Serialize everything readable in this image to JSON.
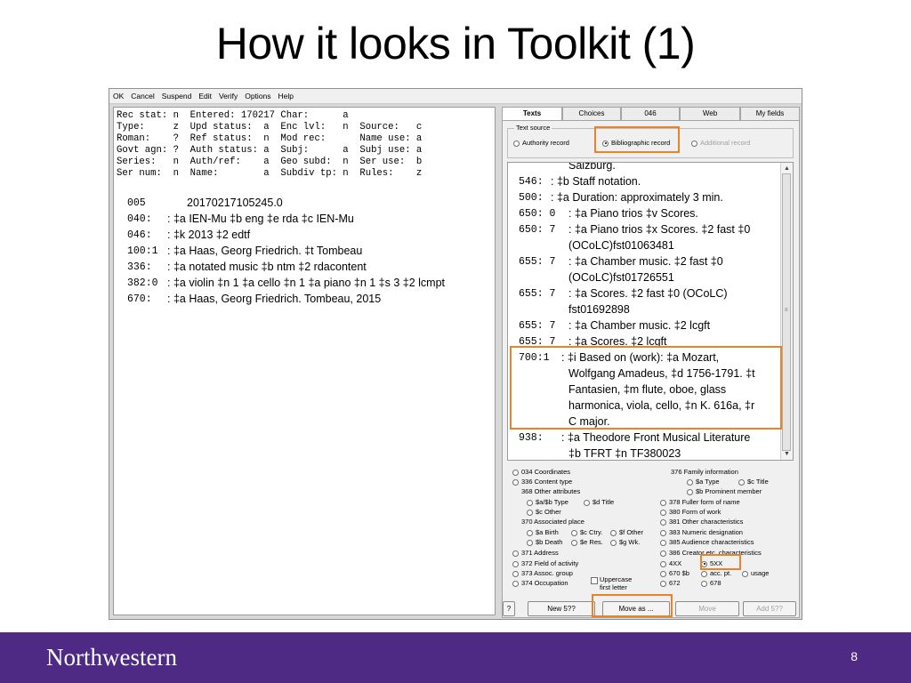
{
  "slide": {
    "title": "How it looks in Toolkit (1)",
    "page_number": "8",
    "brand": "Northwestern"
  },
  "menu": [
    "OK",
    "Cancel",
    "Suspend",
    "Edit",
    "Verify",
    "Options",
    "Help"
  ],
  "fixed_fields": [
    "Rec stat: n  Entered: 170217 Char:      a",
    "Type:     z  Upd status:  a  Enc lvl:   n  Source:   c",
    "Roman:    ?  Ref status:  n  Mod rec:      Name use: a",
    "Govt agn: ?  Auth status: a  Subj:      a  Subj use: a",
    "Series:   n  Auth/ref:    a  Geo subd:  n  Ser use:  b",
    "Ser num:  n  Name:        a  Subdiv tp: n  Rules:    z"
  ],
  "marc_fields": [
    {
      "tag": "005",
      "value": "20170217105245.0"
    },
    {
      "tag": "040:",
      "value": ": ‡a IEN-Mu ‡b eng ‡e rda ‡c IEN-Mu"
    },
    {
      "tag": "046:",
      "value": ": ‡k 2013 ‡2 edtf"
    },
    {
      "tag": "100:1",
      "value": ": ‡a Haas, Georg Friedrich. ‡t Tombeau"
    },
    {
      "tag": "336:",
      "value": ": ‡a notated music ‡b ntm ‡2 rdacontent"
    },
    {
      "tag": "382:0",
      "value": ": ‡a violin ‡n 1 ‡a cello ‡n 1 ‡a piano ‡n 1 ‡s 3 ‡2 lcmpt"
    },
    {
      "tag": "670:",
      "value": ": ‡a Haas, Georg Friedrich. Tombeau, 2015"
    }
  ],
  "tabs": [
    "Texts",
    "Choices",
    "046",
    "Web",
    "My fields"
  ],
  "text_source": {
    "label": "Text source",
    "options": [
      "Authority record",
      "Bibliographic record",
      "Additional record"
    ],
    "selected": "Bibliographic record"
  },
  "text_lines": [
    {
      "tag": "",
      "value": "Salzburg."
    },
    {
      "tag": "546:",
      "value": ": ‡b Staff notation."
    },
    {
      "tag": "500:",
      "value": ": ‡a Duration: approximately 3 min."
    },
    {
      "tag": "650: 0",
      "value": ": ‡a Piano trios ‡v Scores."
    },
    {
      "tag": "650: 7",
      "value": ": ‡a Piano trios ‡x Scores. ‡2 fast ‡0"
    },
    {
      "tag": "",
      "value": "(OCoLC)fst01063481"
    },
    {
      "tag": "655: 7",
      "value": ": ‡a Chamber music. ‡2 fast ‡0"
    },
    {
      "tag": "",
      "value": "(OCoLC)fst01726551"
    },
    {
      "tag": "655: 7",
      "value": ": ‡a Scores. ‡2 fast ‡0 (OCoLC)"
    },
    {
      "tag": "",
      "value": "fst01692898"
    },
    {
      "tag": "655: 7",
      "value": ": ‡a Chamber music. ‡2 lcgft"
    },
    {
      "tag": "655: 7",
      "value": ": ‡a Scores. ‡2 lcgft"
    },
    {
      "tag": "700:1",
      "value": ": ‡i Based on (work): ‡a Mozart,"
    },
    {
      "tag": "",
      "value": "Wolfgang Amadeus, ‡d 1756-1791. ‡t"
    },
    {
      "tag": "",
      "value": "Fantasien, ‡m flute, oboe, glass"
    },
    {
      "tag": "",
      "value": "harmonica, viola, cello, ‡n K. 616a, ‡r"
    },
    {
      "tag": "",
      "value": "C major."
    },
    {
      "tag": "938:",
      "value": ": ‡a Theodore Front Musical Literature"
    },
    {
      "tag": "",
      "value": "‡b TFRT ‡n TF380023"
    }
  ],
  "lower": {
    "left": {
      "coords": "034 Coordinates",
      "content_type": "336 Content type",
      "other_attr": "368 Other attributes",
      "attr_type": "$a/$b Type",
      "attr_dtitle": "$d Title",
      "attr_other": "$c Other",
      "assoc_place": "370 Associated place",
      "birth": "$a Birth",
      "cntry": "$c Ctry.",
      "fother": "$f Other",
      "death": "$b Death",
      "res": "$e Res.",
      "wk": "$g Wk.",
      "address": "371 Address",
      "field_activity": "372 Field of activity",
      "assoc_group": "373 Assoc. group",
      "occupation": "374 Occupation",
      "uppercase": "Uppercase first letter"
    },
    "right": {
      "family": "376 Family information",
      "atype": "$a Type",
      "ctitle": "$c Title",
      "prominent": "$b Prominent member",
      "fuller": "378 Fuller form of name",
      "form_work": "380 Form of work",
      "other_char": "381 Other characteristics",
      "numeric": "383 Numeric designation",
      "audience": "385 Audience characteristics",
      "creator": "386 Creator etc. characteristics",
      "x4xx": "4XX",
      "x5xx": "5XX",
      "f670b": "670 $b",
      "accpt": "acc. pt.",
      "usage": "usage",
      "f672": "672",
      "f678": "678"
    }
  },
  "buttons": {
    "help": "?",
    "new5": "New 5??",
    "move_as": "Move as ...",
    "move": "Move",
    "add5": "Add 5??"
  },
  "colors": {
    "highlight": "#e8832a",
    "footer": "#4e2a84"
  }
}
